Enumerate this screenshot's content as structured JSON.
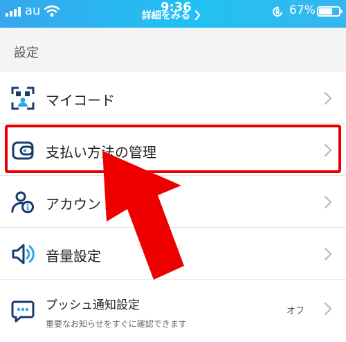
{
  "status_bar": {
    "carrier": "au",
    "time": "9:36",
    "banner": "詳細をみる",
    "battery": "67%"
  },
  "header": {
    "title": "設定"
  },
  "items": [
    {
      "label": "マイコード",
      "icon": "qr-code-icon"
    },
    {
      "label": "支払い方法の管理",
      "icon": "wallet-icon"
    },
    {
      "label": "アカウント",
      "icon": "account-icon"
    },
    {
      "label": "音量設定",
      "icon": "speaker-icon"
    },
    {
      "label": "プッシュ通知設定",
      "sublabel": "重要なお知らせをすぐに確認できます",
      "value": "オフ",
      "icon": "chat-bubble-icon"
    }
  ],
  "colors": {
    "status_gradient_start": "#36a7ee",
    "status_gradient_end": "#21c1f2",
    "icon_navy": "#1a3a6b",
    "icon_accent": "#2aa8e8",
    "highlight_red": "#e80000",
    "chevron": "#b8b8b8"
  }
}
